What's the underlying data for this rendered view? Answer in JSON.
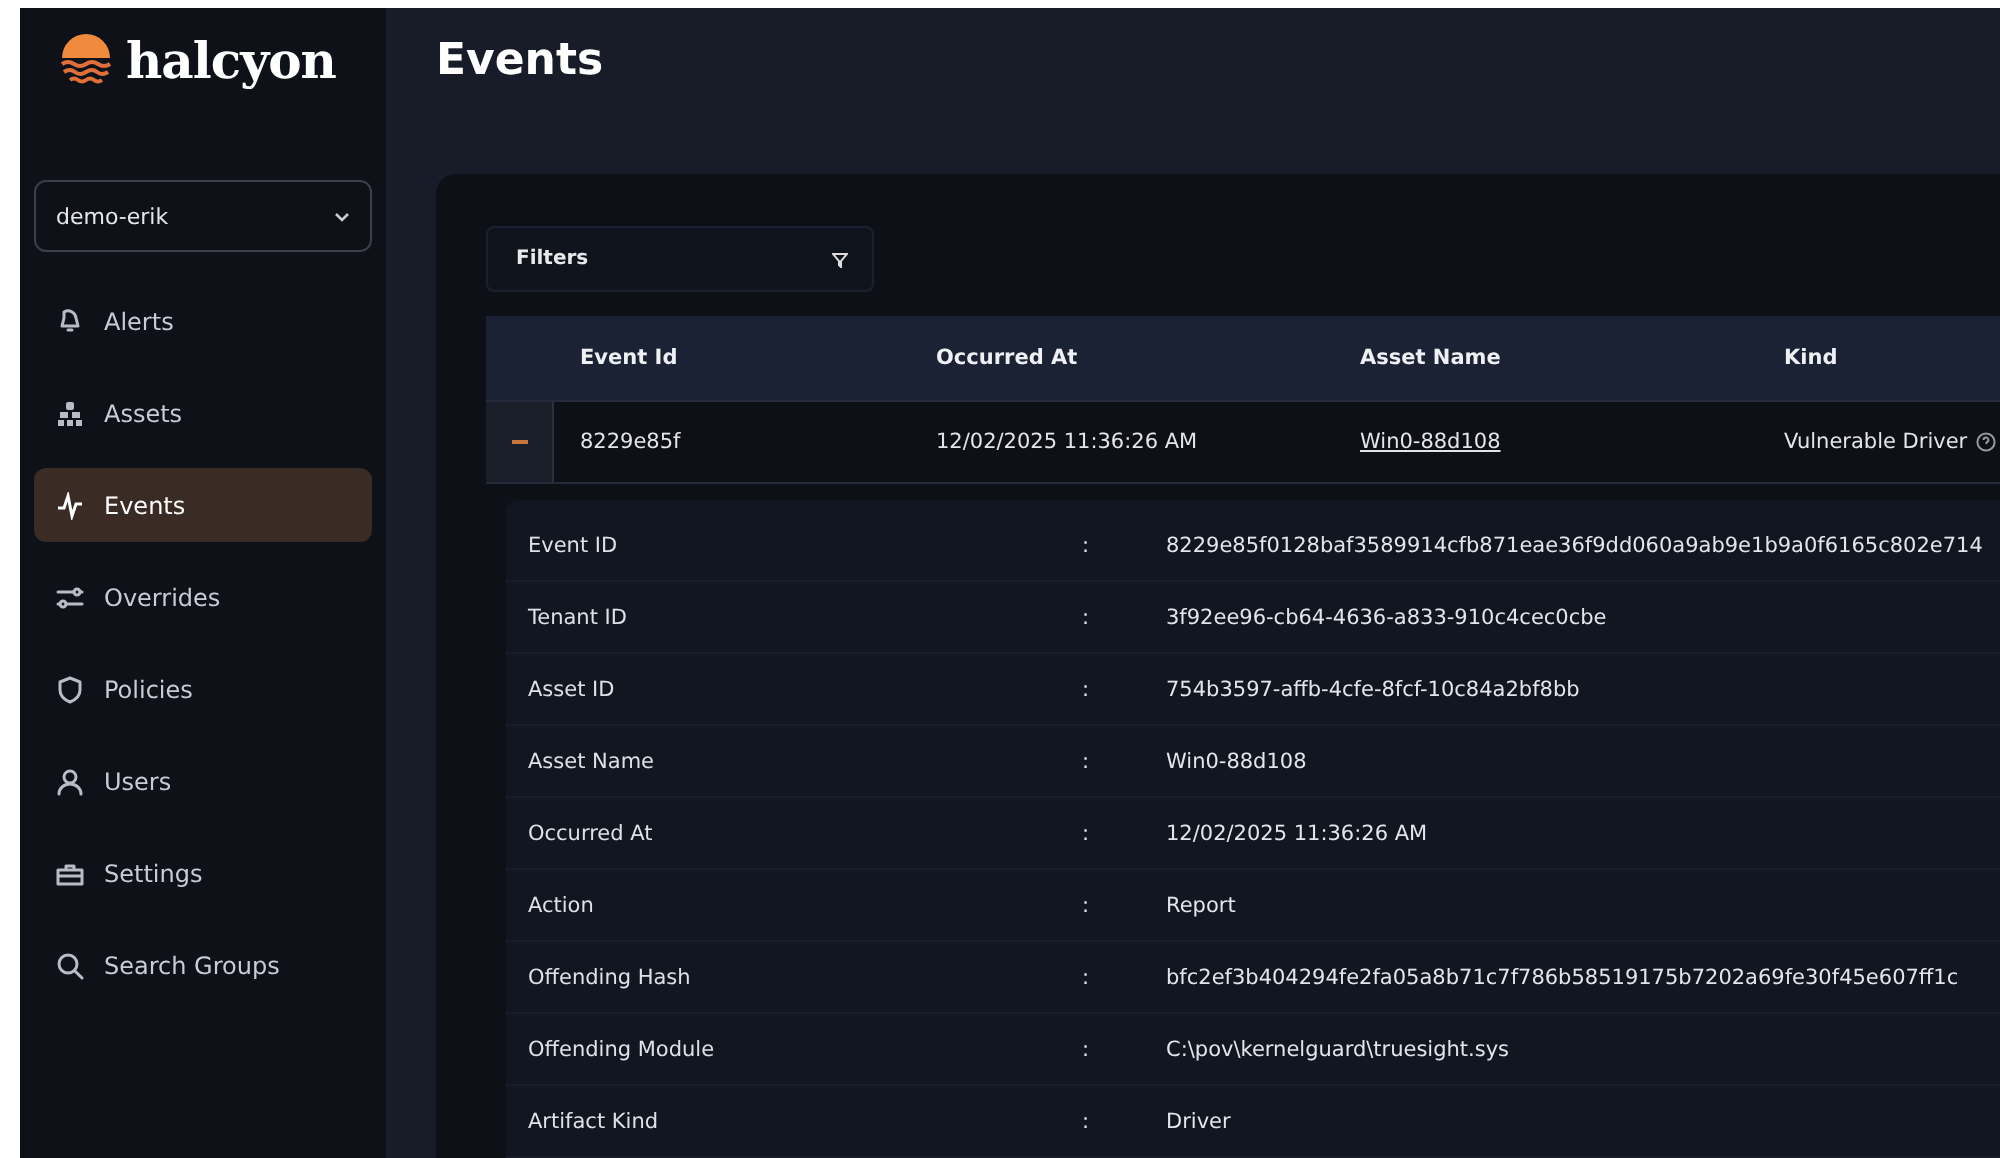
{
  "brand": {
    "name": "halcyon"
  },
  "tenant_select": {
    "value": "demo-erik"
  },
  "sidebar": {
    "items": [
      {
        "label": "Alerts",
        "selected": false
      },
      {
        "label": "Assets",
        "selected": false
      },
      {
        "label": "Events",
        "selected": true
      },
      {
        "label": "Overrides",
        "selected": false
      },
      {
        "label": "Policies",
        "selected": false
      },
      {
        "label": "Users",
        "selected": false
      },
      {
        "label": "Settings",
        "selected": false
      },
      {
        "label": "Search Groups",
        "selected": false
      }
    ]
  },
  "page_title": "Events",
  "filters": {
    "label": "Filters"
  },
  "table": {
    "columns": [
      "Event Id",
      "Occurred At",
      "Asset Name",
      "Kind"
    ],
    "rows": [
      {
        "expanded": true,
        "cells": [
          "8229e85f",
          "12/02/2025 11:36:26 AM",
          "Win0-88d108",
          "Vulnerable Driver"
        ]
      }
    ]
  },
  "details": [
    {
      "label": "Event ID",
      "value": "8229e85f0128baf3589914cfb871eae36f9dd060a9ab9e1b9a0f6165c802e714"
    },
    {
      "label": "Tenant ID",
      "value": "3f92ee96-cb64-4636-a833-910c4cec0cbe"
    },
    {
      "label": "Asset ID",
      "value": "754b3597-affb-4cfe-8fcf-10c84a2bf8bb"
    },
    {
      "label": "Asset Name",
      "value": "Win0-88d108"
    },
    {
      "label": "Occurred At",
      "value": "12/02/2025 11:36:26 AM"
    },
    {
      "label": "Action",
      "value": "Report"
    },
    {
      "label": "Offending Hash",
      "value": "bfc2ef3b404294fe2fa05a8b71c7f786b58519175b7202a69fe30f45e607ff1c"
    },
    {
      "label": "Offending Module",
      "value": "C:\\pov\\kernelguard\\truesight.sys"
    },
    {
      "label": "Artifact Kind",
      "value": "Driver"
    }
  ],
  "detail_separator": ":"
}
